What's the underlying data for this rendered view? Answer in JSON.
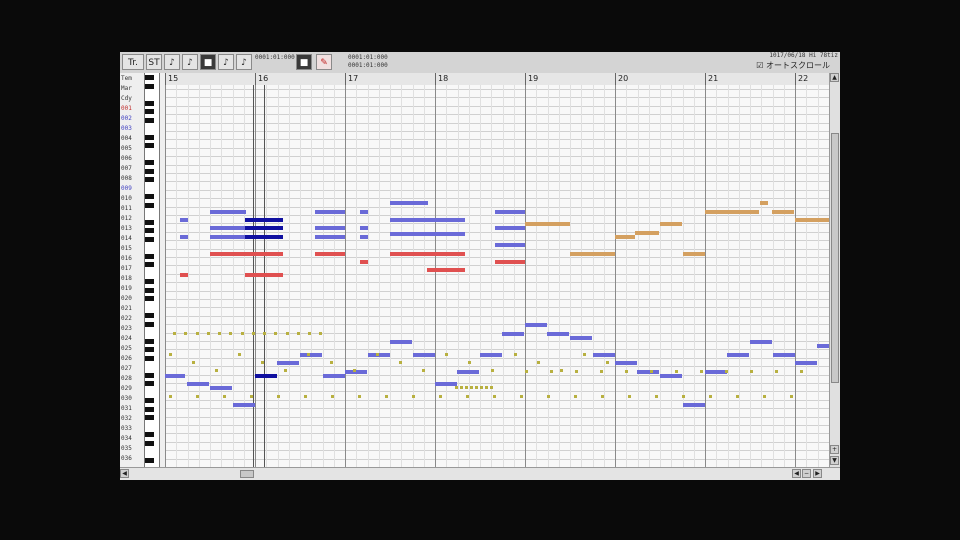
{
  "toolbar": {
    "buttons": [
      "Tr.",
      "ST",
      "♪",
      "♪",
      "■",
      "♪",
      "♪",
      "■",
      "✎"
    ],
    "position1": "0001:01:000",
    "position2a": "0001:01:000",
    "position2b": "0001:01:000",
    "status": "1017/06/18 Hi 78tiz  ",
    "autoscroll_label": "☑ オートスクロール"
  },
  "ruler": {
    "measures": [
      "15",
      "16",
      "17",
      "18",
      "19",
      "20",
      "21",
      "22"
    ]
  },
  "tracks": [
    "Tem",
    "Mar",
    "Cdy",
    "001",
    "002",
    "003",
    "004",
    "005",
    "006",
    "007",
    "008",
    "009",
    "010",
    "011",
    "012",
    "013",
    "014",
    "015",
    "016",
    "017",
    "018",
    "019",
    "020",
    "021",
    "022",
    "023",
    "024",
    "025",
    "026",
    "027",
    "028",
    "029",
    "030",
    "031",
    "032",
    "033",
    "034",
    "035",
    "036"
  ],
  "track_colors": {
    "001": "#c03030",
    "002": "#4040c0",
    "003": "#4040c0",
    "009": "#4040c0"
  },
  "colors": {
    "blue": "#6a6ad8",
    "dark_blue": "#1010a0",
    "red": "#e05050",
    "orange": "#d4a060",
    "yellow_dot": "#b8b040"
  }
}
